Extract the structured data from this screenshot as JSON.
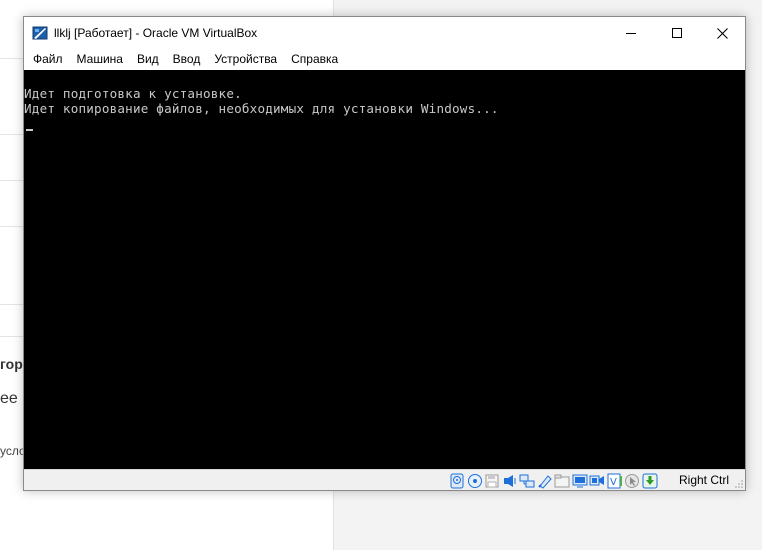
{
  "window": {
    "title": "llklj [Работает] - Oracle VM VirtualBox"
  },
  "menu": {
    "items": [
      "Файл",
      "Машина",
      "Вид",
      "Ввод",
      "Устройства",
      "Справка"
    ]
  },
  "console": {
    "line1": "Идет подготовка к установке.",
    "line2": "Идет копирование файлов, необходимых для установки Windows..."
  },
  "statusbar": {
    "host_key": "Right Ctrl",
    "icons": [
      "hard-disk-icon",
      "optical-drive-icon",
      "floppy-icon",
      "audio-icon",
      "network-icon",
      "usb-icon",
      "shared-folders-icon",
      "display-icon",
      "video-capture-icon",
      "cpu-virtualization-icon",
      "mouse-integration-icon",
      "keyboard-capture-icon"
    ]
  },
  "background": {
    "fragment1": "гор",
    "fragment2": "ее к",
    "fragment3": "усло"
  },
  "colors": {
    "screen_bg": "#000000",
    "console_text": "#c8c8c8",
    "statusbar_bg": "#f0f0f0",
    "accent": "#1e6fd9"
  }
}
